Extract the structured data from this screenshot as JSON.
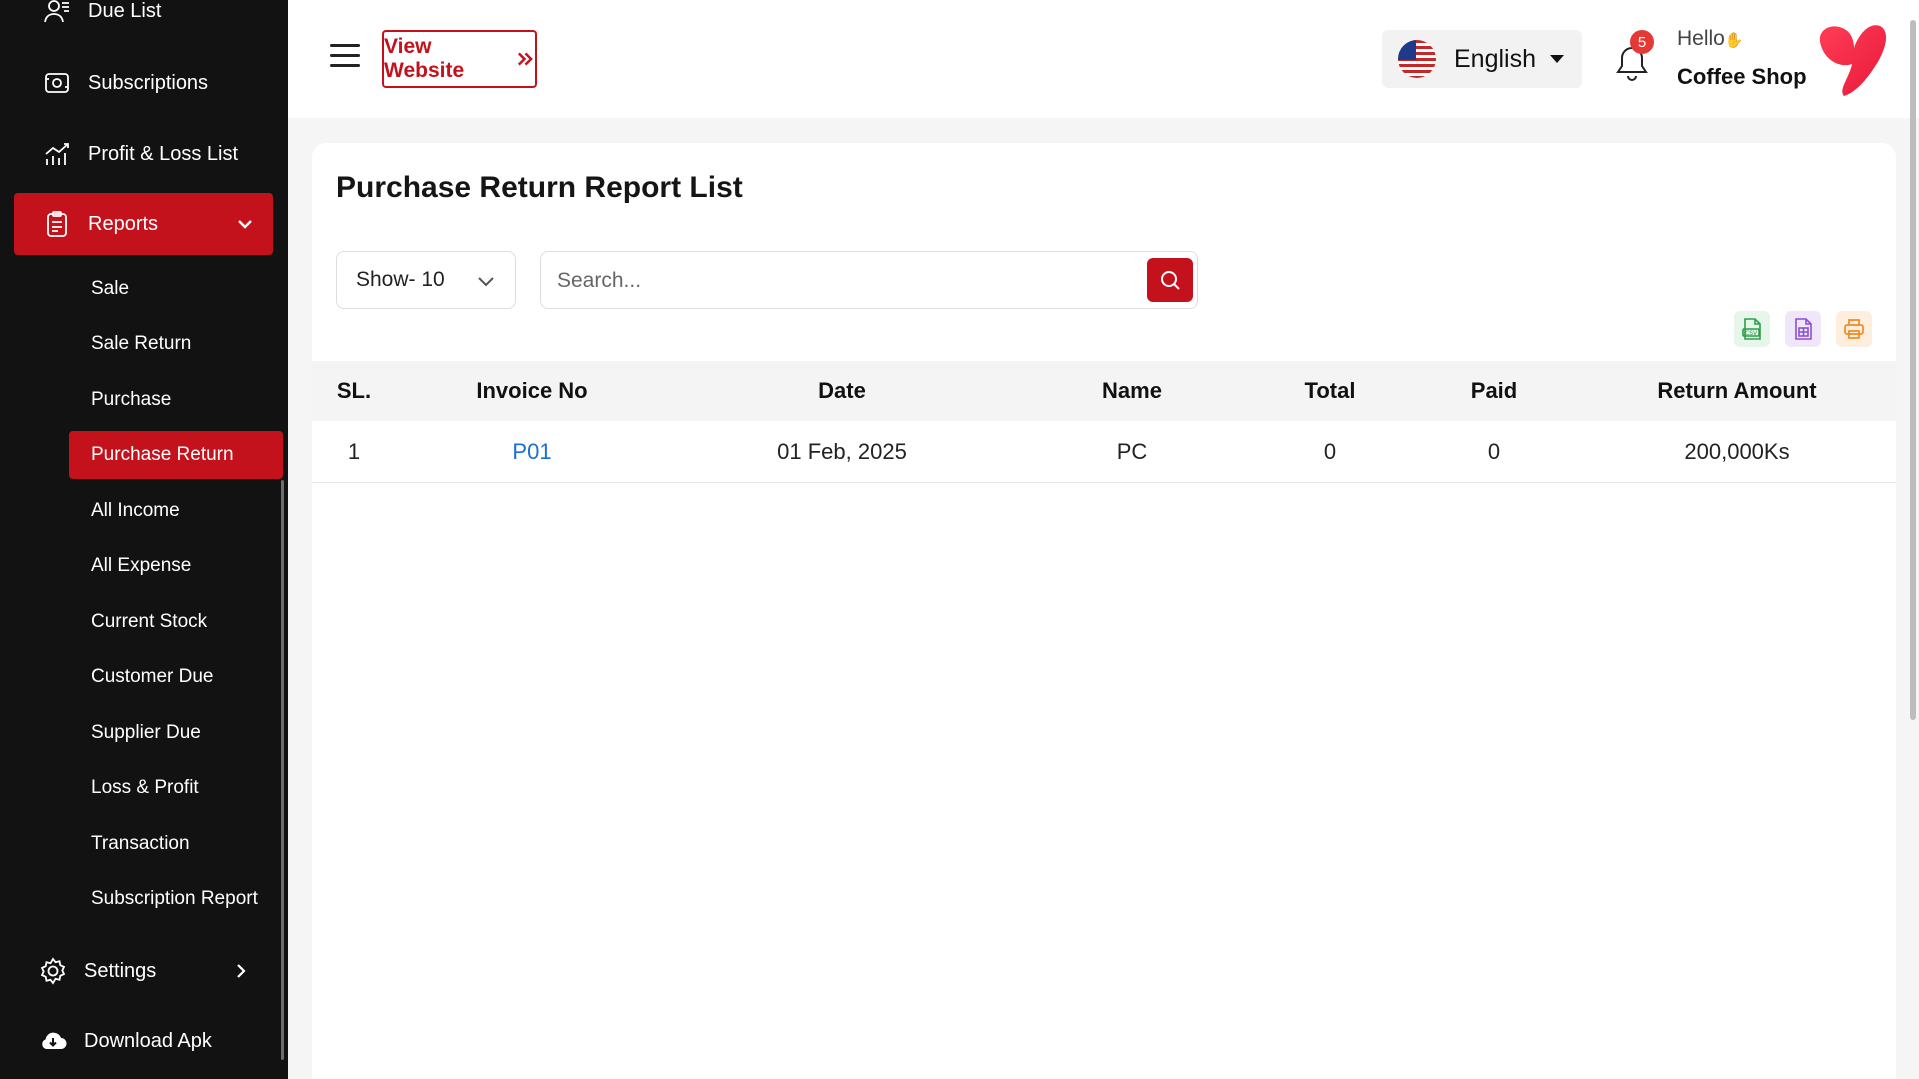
{
  "sidebar": {
    "items": [
      {
        "label": "Due List",
        "icon": "due-list-icon"
      },
      {
        "label": "Subscriptions",
        "icon": "subscriptions-icon"
      },
      {
        "label": "Profit & Loss List",
        "icon": "profit-loss-icon"
      },
      {
        "label": "Reports",
        "icon": "reports-icon",
        "active": true
      }
    ],
    "sub_items": [
      "Sale",
      "Sale Return",
      "Purchase",
      "Purchase Return",
      "All Income",
      "All Expense",
      "Current Stock",
      "Customer Due",
      "Supplier Due",
      "Loss & Profit",
      "Transaction",
      "Subscription Report"
    ],
    "active_sub": "Purchase Return",
    "bottom_items": [
      {
        "label": "Settings",
        "icon": "settings-icon"
      },
      {
        "label": "Download Apk",
        "icon": "cloud-download-icon"
      }
    ]
  },
  "header": {
    "view_website": "View Website",
    "language": "English",
    "notification_count": "5",
    "greeting": "Hello",
    "shop_name": "Coffee Shop"
  },
  "main": {
    "title": "Purchase Return Report List",
    "show_select": "Show- 10",
    "search_placeholder": "Search...",
    "columns": [
      "SL.",
      "Invoice No",
      "Date",
      "Name",
      "Total",
      "Paid",
      "Return Amount"
    ],
    "rows": [
      {
        "sl": "1",
        "invoice": "P01",
        "date": "01 Feb, 2025",
        "name": "PC",
        "total": "0",
        "paid": "0",
        "return_amount": "200,000Ks"
      }
    ]
  },
  "colors": {
    "accent": "#c4121d",
    "sidebar_bg": "#121212",
    "link": "#1a6fd6",
    "badge": "#e53935"
  }
}
